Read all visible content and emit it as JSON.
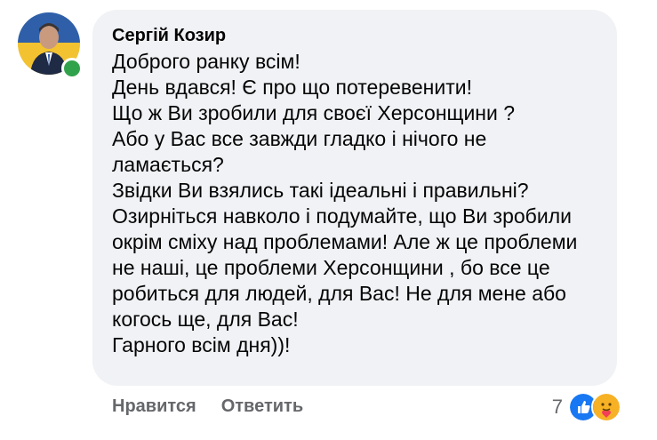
{
  "comment": {
    "author": "Сергій Козир",
    "text": "Доброго ранку всім!\nДень вдався! Є про що потеревенити!\nЩо ж Ви зробили для своєї Херсонщини ?\nАбо у Вас все завжди гладко і нічого не ламається?\nЗвідки Ви взялись такі ідеальні і правильні? Озирніться навколо і подумайте, що Ви зробили окрім сміху над проблемами! Але ж це проблеми не наші, це проблеми Херсонщини , бо все це робиться для людей, для Вас! Не для мене або когось ще, для Вас!\nГарного всім дня))!",
    "online": true
  },
  "actions": {
    "like_label": "Нравится",
    "reply_label": "Ответить"
  },
  "reactions": {
    "count": "7",
    "icons": [
      "like-icon",
      "care-icon"
    ]
  },
  "colors": {
    "bubble": "#f0f2f5",
    "text": "#050505",
    "muted": "#65676b",
    "online": "#31a24c",
    "like": "#1877f2",
    "care": "#f7b125"
  }
}
